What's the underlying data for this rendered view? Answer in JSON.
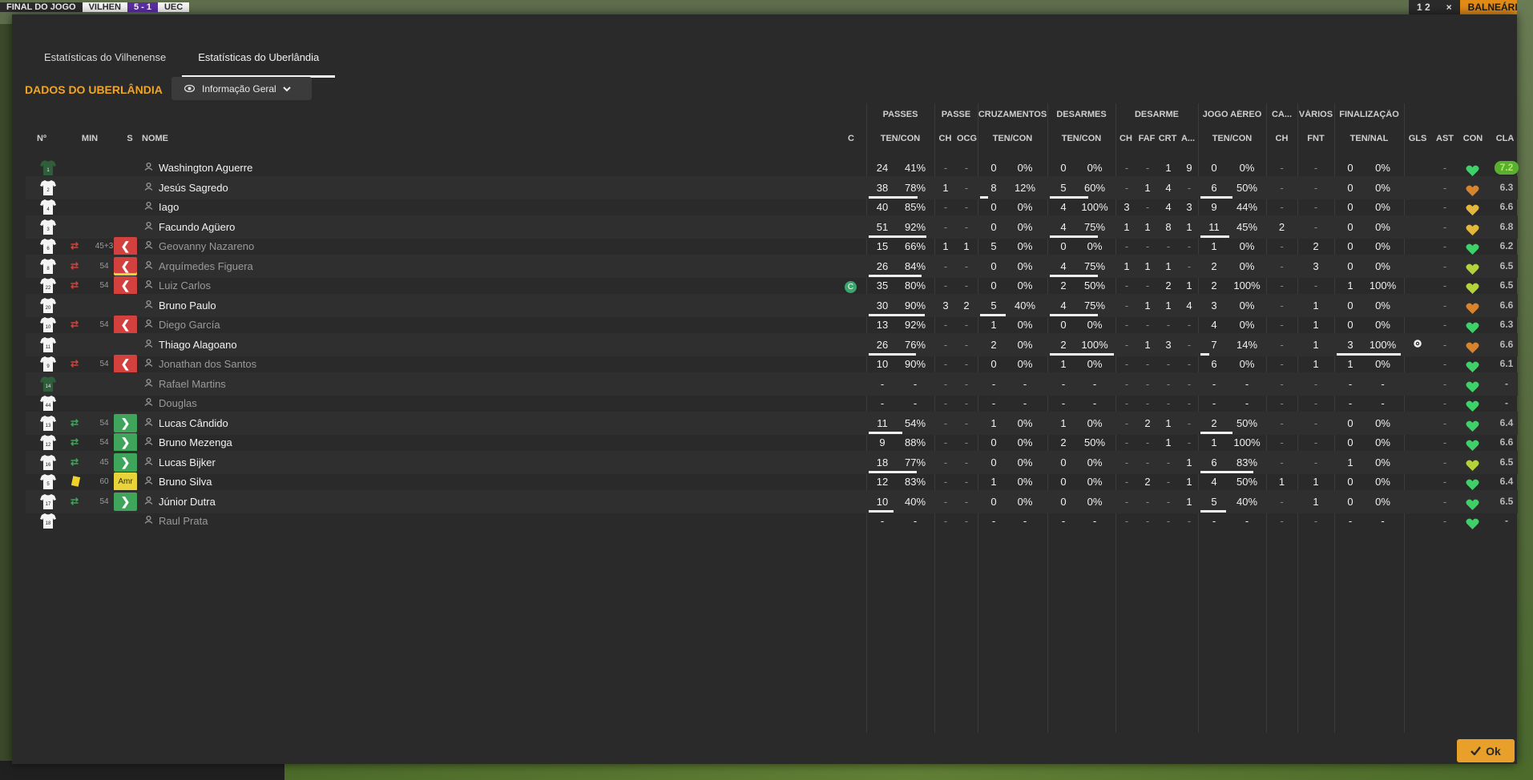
{
  "background": {
    "left_bar": [
      "FINAL DO JOGO",
      "VILHEN",
      "5 - 1",
      "UEC"
    ],
    "right_bar": [
      "1 2",
      "×",
      "BALNEÁRIO"
    ]
  },
  "tabs": [
    {
      "label": "Estatísticas do Vilhenense",
      "active": false
    },
    {
      "label": "Estatísticas do Uberlândia",
      "active": true
    }
  ],
  "section_title": "DADOS DO UBERLÂNDIA",
  "view_select": {
    "label": "Informação Geral",
    "icon": "eye-icon"
  },
  "groups": {
    "passes": "PASSES",
    "passe": "PASSE",
    "cruz": "CRUZAMENTOS",
    "desarmes": "DESARMES",
    "desarme": "DESARME",
    "aereo": "JOGO AÉREO",
    "ca": "CA...",
    "varios": "VÁRIOS",
    "final": "FINALIZAÇÃO"
  },
  "headers": {
    "no": "Nº",
    "min": "MIN",
    "s": "S",
    "nome": "NOME",
    "c": "C",
    "passes": "TEN/CON",
    "passe_ch": "CH",
    "passe_ocg": "OCG",
    "cruz": "TEN/CON",
    "desarmes": "TEN/CON",
    "d_ch": "CH",
    "d_faf": "FAF",
    "d_crt": "CRT",
    "d_a": "A...",
    "aereo": "TEN/CON",
    "ca_ch": "CH",
    "fnt": "FNT",
    "final": "TEN/NAL",
    "gls": "GLS",
    "ast": "AST",
    "con": "CON",
    "cla": "CLA"
  },
  "players": [
    {
      "no": "1",
      "min": "",
      "sub": "",
      "name": "Washington Aguerre",
      "used": true,
      "gk": true,
      "cap": false,
      "passes": [
        "24",
        "41%"
      ],
      "passe": [
        "-",
        "-"
      ],
      "cruz": [
        "0",
        "0%"
      ],
      "desarmes": [
        "0",
        "0%"
      ],
      "desarme": [
        "-",
        "-",
        "1",
        "9"
      ],
      "aereo": [
        "0",
        "0%"
      ],
      "ca": "-",
      "fnt": "-",
      "final": [
        "0",
        "0%"
      ],
      "gls": "",
      "ast": "-",
      "con": "green",
      "cla": "7.2",
      "best": true,
      "cog": false,
      "pb": 0.41,
      "cb": 0,
      "db": 0,
      "ab": 0,
      "fb": 0
    },
    {
      "no": "2",
      "min": "",
      "sub": "",
      "name": "Jesús Sagredo",
      "used": true,
      "cap": false,
      "passes": [
        "38",
        "78%"
      ],
      "passe": [
        "1",
        "-"
      ],
      "cruz": [
        "8",
        "12%"
      ],
      "desarmes": [
        "5",
        "60%"
      ],
      "desarme": [
        "-",
        "1",
        "4",
        "-"
      ],
      "aereo": [
        "6",
        "50%"
      ],
      "ca": "-",
      "fnt": "-",
      "final": [
        "0",
        "0%"
      ],
      "gls": "",
      "ast": "-",
      "con": "orange",
      "cla": "6.3",
      "pb": 0.78,
      "cb": 0.12,
      "db": 0.6,
      "ab": 0.5,
      "fb": 0
    },
    {
      "no": "4",
      "min": "",
      "sub": "",
      "name": "Iago",
      "used": true,
      "passes": [
        "40",
        "85%"
      ],
      "passe": [
        "-",
        "-"
      ],
      "cruz": [
        "0",
        "0%"
      ],
      "desarmes": [
        "4",
        "100%"
      ],
      "desarme": [
        "3",
        "-",
        "4",
        "3"
      ],
      "aereo": [
        "9",
        "44%"
      ],
      "ca": "-",
      "fnt": "-",
      "final": [
        "0",
        "0%"
      ],
      "gls": "",
      "ast": "-",
      "con": "yellow",
      "cla": "6.6",
      "pb": 0.85,
      "cb": 0,
      "db": 1,
      "ab": 0.44,
      "fb": 0
    },
    {
      "no": "3",
      "min": "",
      "sub": "",
      "name": "Facundo Agüero",
      "used": true,
      "passes": [
        "51",
        "92%"
      ],
      "passe": [
        "-",
        "-"
      ],
      "cruz": [
        "0",
        "0%"
      ],
      "desarmes": [
        "4",
        "75%"
      ],
      "desarme": [
        "1",
        "1",
        "8",
        "1"
      ],
      "aereo": [
        "11",
        "45%"
      ],
      "ca": "2",
      "fnt": "-",
      "final": [
        "0",
        "0%"
      ],
      "gls": "",
      "ast": "-",
      "con": "yellow",
      "cla": "6.8",
      "pb": 0.92,
      "cb": 0,
      "db": 0.75,
      "ab": 0.45,
      "fb": 0
    },
    {
      "no": "6",
      "min": "45+3",
      "sub": "out",
      "name": "Geovanny Nazareno",
      "used": false,
      "passes": [
        "15",
        "66%"
      ],
      "passe": [
        "1",
        "1"
      ],
      "cruz": [
        "5",
        "0%"
      ],
      "desarmes": [
        "0",
        "0%"
      ],
      "desarme": [
        "-",
        "-",
        "-",
        "-"
      ],
      "aereo": [
        "1",
        "0%"
      ],
      "ca": "-",
      "fnt": "2",
      "final": [
        "0",
        "0%"
      ],
      "gls": "",
      "ast": "-",
      "con": "green",
      "cla": "6.2",
      "pb": 0.66,
      "cb": 0,
      "db": 0,
      "ab": 0,
      "fb": 0
    },
    {
      "no": "8",
      "min": "54",
      "sub": "out-card",
      "name": "Arquímedes Figuera",
      "used": false,
      "passes": [
        "26",
        "84%"
      ],
      "passe": [
        "-",
        "-"
      ],
      "cruz": [
        "0",
        "0%"
      ],
      "desarmes": [
        "4",
        "75%"
      ],
      "desarme": [
        "1",
        "1",
        "1",
        "-"
      ],
      "aereo": [
        "2",
        "0%"
      ],
      "ca": "-",
      "fnt": "3",
      "final": [
        "0",
        "0%"
      ],
      "gls": "",
      "ast": "-",
      "con": "yellowgreen",
      "cla": "6.5",
      "pb": 0.84,
      "cb": 0,
      "db": 0.75,
      "ab": 0,
      "fb": 0
    },
    {
      "no": "22",
      "min": "54",
      "sub": "out",
      "name": "Luiz Carlos",
      "used": false,
      "cap": true,
      "passes": [
        "35",
        "80%"
      ],
      "passe": [
        "-",
        "-"
      ],
      "cruz": [
        "0",
        "0%"
      ],
      "desarmes": [
        "2",
        "50%"
      ],
      "desarme": [
        "-",
        "-",
        "2",
        "1"
      ],
      "aereo": [
        "2",
        "100%"
      ],
      "ca": "-",
      "fnt": "-",
      "final": [
        "1",
        "100%"
      ],
      "gls": "",
      "ast": "-",
      "con": "yellowgreen",
      "cla": "6.5",
      "pb": 0.8,
      "cb": 0,
      "db": 0.5,
      "ab": 1,
      "fb": 1
    },
    {
      "no": "20",
      "min": "",
      "sub": "",
      "name": "Bruno Paulo",
      "used": true,
      "passes": [
        "30",
        "90%"
      ],
      "passe": [
        "3",
        "2"
      ],
      "cruz": [
        "5",
        "40%"
      ],
      "desarmes": [
        "4",
        "75%"
      ],
      "desarme": [
        "-",
        "1",
        "1",
        "4"
      ],
      "aereo": [
        "3",
        "0%"
      ],
      "ca": "-",
      "fnt": "1",
      "final": [
        "0",
        "0%"
      ],
      "gls": "",
      "ast": "-",
      "con": "orange",
      "cla": "6.6",
      "pb": 0.9,
      "cb": 0.4,
      "db": 0.75,
      "ab": 0,
      "fb": 0
    },
    {
      "no": "10",
      "min": "54",
      "sub": "out",
      "name": "Diego García",
      "used": false,
      "passes": [
        "13",
        "92%"
      ],
      "passe": [
        "-",
        "-"
      ],
      "cruz": [
        "1",
        "0%"
      ],
      "desarmes": [
        "0",
        "0%"
      ],
      "desarme": [
        "-",
        "-",
        "-",
        "-"
      ],
      "aereo": [
        "4",
        "0%"
      ],
      "ca": "-",
      "fnt": "1",
      "final": [
        "0",
        "0%"
      ],
      "gls": "",
      "ast": "-",
      "con": "green",
      "cla": "6.3",
      "pb": 0.92,
      "cb": 0,
      "db": 0,
      "ab": 0,
      "fb": 0
    },
    {
      "no": "11",
      "min": "",
      "sub": "",
      "name": "Thiago Alagoano",
      "used": true,
      "passes": [
        "26",
        "76%"
      ],
      "passe": [
        "-",
        "-"
      ],
      "cruz": [
        "2",
        "0%"
      ],
      "desarmes": [
        "2",
        "100%"
      ],
      "desarme": [
        "-",
        "1",
        "3",
        "-"
      ],
      "aereo": [
        "7",
        "14%"
      ],
      "ca": "-",
      "fnt": "1",
      "final": [
        "3",
        "100%"
      ],
      "gls": "cog",
      "ast": "-",
      "con": "orange",
      "cla": "6.6",
      "pb": 0.76,
      "cb": 0,
      "db": 1,
      "ab": 0.14,
      "fb": 1
    },
    {
      "no": "9",
      "min": "54",
      "sub": "out",
      "name": "Jonathan dos Santos",
      "used": false,
      "passes": [
        "10",
        "90%"
      ],
      "passe": [
        "-",
        "-"
      ],
      "cruz": [
        "0",
        "0%"
      ],
      "desarmes": [
        "1",
        "0%"
      ],
      "desarme": [
        "-",
        "-",
        "-",
        "-"
      ],
      "aereo": [
        "6",
        "0%"
      ],
      "ca": "-",
      "fnt": "1",
      "final": [
        "1",
        "0%"
      ],
      "gls": "",
      "ast": "-",
      "con": "green",
      "cla": "6.1",
      "pb": 0.9,
      "cb": 0,
      "db": 0,
      "ab": 0,
      "fb": 0
    },
    {
      "no": "14",
      "min": "",
      "sub": "",
      "name": "Rafael Martins",
      "used": false,
      "gk": true,
      "passes": [
        "-",
        "-"
      ],
      "passe": [
        "-",
        "-"
      ],
      "cruz": [
        "-",
        "-"
      ],
      "desarmes": [
        "-",
        "-"
      ],
      "desarme": [
        "-",
        "-",
        "-",
        "-"
      ],
      "aereo": [
        "-",
        "-"
      ],
      "ca": "-",
      "fnt": "-",
      "final": [
        "-",
        "-"
      ],
      "gls": "",
      "ast": "-",
      "con": "green",
      "cla": "-",
      "pb": 0,
      "cb": 0,
      "db": 0,
      "ab": 0,
      "fb": 0
    },
    {
      "no": "44",
      "min": "",
      "sub": "",
      "name": "Douglas",
      "used": false,
      "passes": [
        "-",
        "-"
      ],
      "passe": [
        "-",
        "-"
      ],
      "cruz": [
        "-",
        "-"
      ],
      "desarmes": [
        "-",
        "-"
      ],
      "desarme": [
        "-",
        "-",
        "-",
        "-"
      ],
      "aereo": [
        "-",
        "-"
      ],
      "ca": "-",
      "fnt": "-",
      "final": [
        "-",
        "-"
      ],
      "gls": "",
      "ast": "-",
      "con": "green",
      "cla": "-",
      "pb": 0,
      "cb": 0,
      "db": 0,
      "ab": 0,
      "fb": 0
    },
    {
      "no": "13",
      "min": "54",
      "sub": "in",
      "name": "Lucas Cândido",
      "used": true,
      "passes": [
        "11",
        "54%"
      ],
      "passe": [
        "-",
        "-"
      ],
      "cruz": [
        "1",
        "0%"
      ],
      "desarmes": [
        "1",
        "0%"
      ],
      "desarme": [
        "-",
        "2",
        "1",
        "-"
      ],
      "aereo": [
        "2",
        "50%"
      ],
      "ca": "-",
      "fnt": "-",
      "final": [
        "0",
        "0%"
      ],
      "gls": "",
      "ast": "-",
      "con": "green",
      "cla": "6.4",
      "pb": 0.54,
      "cb": 0,
      "db": 0,
      "ab": 0.5,
      "fb": 0
    },
    {
      "no": "12",
      "min": "54",
      "sub": "in",
      "name": "Bruno Mezenga",
      "used": true,
      "passes": [
        "9",
        "88%"
      ],
      "passe": [
        "-",
        "-"
      ],
      "cruz": [
        "0",
        "0%"
      ],
      "desarmes": [
        "2",
        "50%"
      ],
      "desarme": [
        "-",
        "-",
        "1",
        "-"
      ],
      "aereo": [
        "1",
        "100%"
      ],
      "ca": "-",
      "fnt": "-",
      "final": [
        "0",
        "0%"
      ],
      "gls": "",
      "ast": "-",
      "con": "green",
      "cla": "6.6",
      "pb": 0.88,
      "cb": 0,
      "db": 0.5,
      "ab": 1,
      "fb": 0
    },
    {
      "no": "16",
      "min": "45",
      "sub": "in",
      "name": "Lucas Bijker",
      "used": true,
      "passes": [
        "18",
        "77%"
      ],
      "passe": [
        "-",
        "-"
      ],
      "cruz": [
        "0",
        "0%"
      ],
      "desarmes": [
        "0",
        "0%"
      ],
      "desarme": [
        "-",
        "-",
        "-",
        "1"
      ],
      "aereo": [
        "6",
        "83%"
      ],
      "ca": "-",
      "fnt": "-",
      "final": [
        "1",
        "0%"
      ],
      "gls": "",
      "ast": "-",
      "con": "yellowgreen",
      "cla": "6.5",
      "pb": 0.77,
      "cb": 0,
      "db": 0,
      "ab": 0.83,
      "fb": 0
    },
    {
      "no": "5",
      "min": "60",
      "sub": "card",
      "name": "Bruno Silva",
      "used": true,
      "ycard": true,
      "passes": [
        "12",
        "83%"
      ],
      "passe": [
        "-",
        "-"
      ],
      "cruz": [
        "1",
        "0%"
      ],
      "desarmes": [
        "0",
        "0%"
      ],
      "desarme": [
        "-",
        "2",
        "-",
        "1"
      ],
      "aereo": [
        "4",
        "50%"
      ],
      "ca": "1",
      "fnt": "1",
      "final": [
        "0",
        "0%"
      ],
      "gls": "",
      "ast": "-",
      "con": "green",
      "cla": "6.4",
      "pb": 0.83,
      "cb": 0,
      "db": 0,
      "ab": 0.5,
      "fb": 0
    },
    {
      "no": "17",
      "min": "54",
      "sub": "in",
      "name": "Júnior Dutra",
      "used": true,
      "passes": [
        "10",
        "40%"
      ],
      "passe": [
        "-",
        "-"
      ],
      "cruz": [
        "0",
        "0%"
      ],
      "desarmes": [
        "0",
        "0%"
      ],
      "desarme": [
        "-",
        "-",
        "-",
        "1"
      ],
      "aereo": [
        "5",
        "40%"
      ],
      "ca": "-",
      "fnt": "1",
      "final": [
        "0",
        "0%"
      ],
      "gls": "",
      "ast": "-",
      "con": "green",
      "cla": "6.5",
      "pb": 0.4,
      "cb": 0,
      "db": 0,
      "ab": 0.4,
      "fb": 0
    },
    {
      "no": "18",
      "min": "",
      "sub": "",
      "name": "Raul Prata",
      "used": false,
      "passes": [
        "-",
        "-"
      ],
      "passe": [
        "-",
        "-"
      ],
      "cruz": [
        "-",
        "-"
      ],
      "desarmes": [
        "-",
        "-"
      ],
      "desarme": [
        "-",
        "-",
        "-",
        "-"
      ],
      "aereo": [
        "-",
        "-"
      ],
      "ca": "-",
      "fnt": "-",
      "final": [
        "-",
        "-"
      ],
      "gls": "",
      "ast": "-",
      "con": "green",
      "cla": "-",
      "pb": 0,
      "cb": 0,
      "db": 0,
      "ab": 0,
      "fb": 0
    }
  ],
  "sub_card_label": "Amr",
  "captain_letter": "C",
  "ok_label": "Ok",
  "colors": {
    "accent": "#f1a526",
    "green": "#3fd06a",
    "yellowgreen": "#b4d23c",
    "yellow": "#e2b73b",
    "orange": "#d8842f",
    "out": "#d2413d",
    "in": "#3ea55a"
  }
}
